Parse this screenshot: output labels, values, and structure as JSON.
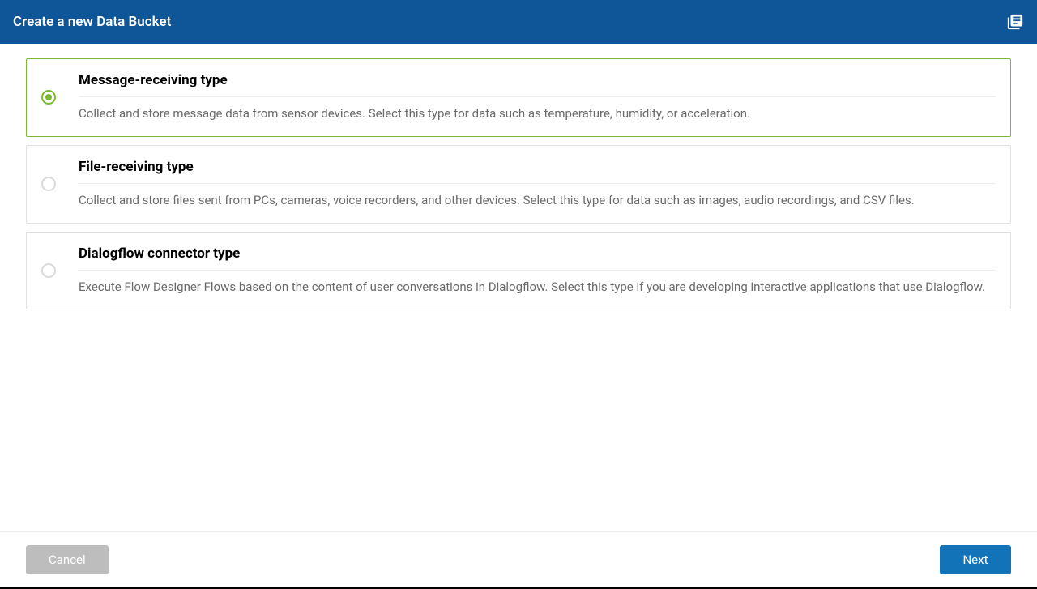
{
  "header": {
    "title": "Create a new Data Bucket"
  },
  "options": [
    {
      "name": "option-message-receiving",
      "title": "Message-receiving type",
      "desc": "Collect and store message data from sensor devices. Select this type for data such as temperature, humidity, or acceleration.",
      "selected": true
    },
    {
      "name": "option-file-receiving",
      "title": "File-receiving type",
      "desc": "Collect and store files sent from PCs, cameras, voice recorders, and other devices. Select this type for data such as images, audio recordings, and CSV files.",
      "selected": false
    },
    {
      "name": "option-dialogflow-connector",
      "title": "Dialogflow connector type",
      "desc": "Execute Flow Designer Flows based on the content of user conversations in Dialogflow. Select this type if you are developing interactive applications that use Dialogflow.",
      "selected": false
    }
  ],
  "footer": {
    "cancel_label": "Cancel",
    "next_label": "Next"
  }
}
